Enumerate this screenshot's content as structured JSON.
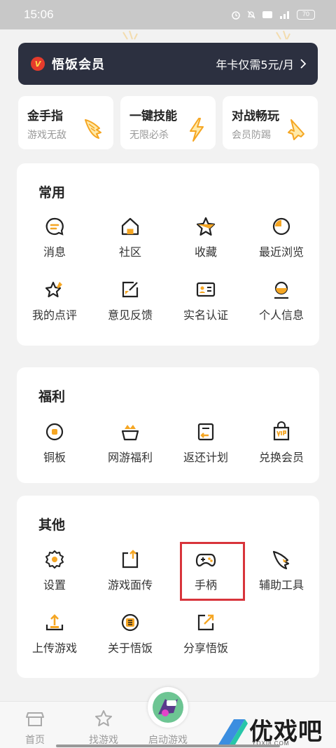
{
  "status_bar": {
    "time": "15:06",
    "battery": "70"
  },
  "vip_banner": {
    "badge": "V",
    "title": "悟饭会员",
    "offer": "年卡仅需5元/月"
  },
  "features": [
    {
      "title": "金手指",
      "subtitle": "游戏无敌",
      "icon": "wing-icon"
    },
    {
      "title": "一键技能",
      "subtitle": "无限必杀",
      "icon": "lightning-icon"
    },
    {
      "title": "对战畅玩",
      "subtitle": "会员防踢",
      "icon": "rocket-icon"
    }
  ],
  "sections": {
    "common": {
      "title": "常用",
      "items": [
        "消息",
        "社区",
        "收藏",
        "最近浏览",
        "我的点评",
        "意见反馈",
        "实名认证",
        "个人信息"
      ]
    },
    "welfare": {
      "title": "福利",
      "items": [
        "铜板",
        "网游福利",
        "返还计划",
        "兑换会员"
      ]
    },
    "other": {
      "title": "其他",
      "items": [
        "设置",
        "游戏面传",
        "手柄",
        "辅助工具",
        "上传游戏",
        "关于悟饭",
        "分享悟饭"
      ]
    }
  },
  "bottom_nav": [
    "首页",
    "找游戏",
    "启动游戏"
  ],
  "watermark": {
    "text": "优戏吧",
    "url": "YOXI8.COM"
  },
  "colors": {
    "accent": "#f5a623",
    "banner": "#2c3040",
    "highlight": "#d8343b"
  }
}
